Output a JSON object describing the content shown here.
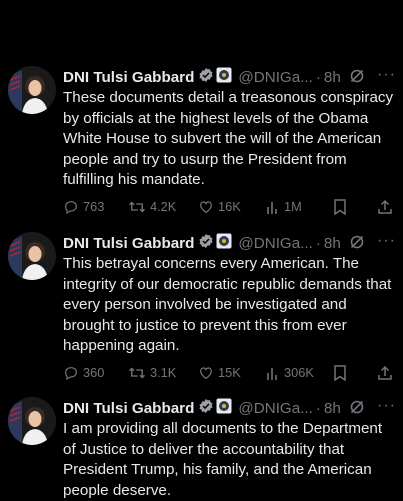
{
  "tweets": [
    {
      "display_name": "DNI Tulsi Gabbard",
      "handle": "@DNIGa...",
      "separator": "·",
      "time": "8h",
      "more": "···",
      "text": "These documents detail a treasonous conspiracy by officials at the highest levels of the Obama White House to subvert the will of the American people and try to usurp the President from fulfilling his mandate.",
      "replies": "763",
      "reposts": "4.2K",
      "likes": "16K",
      "views": "1M"
    },
    {
      "display_name": "DNI Tulsi Gabbard",
      "handle": "@DNIGa...",
      "separator": "·",
      "time": "8h",
      "more": "···",
      "text": "This betrayal concerns every American. The integrity of our democratic republic demands that every person involved be investigated and brought to justice to prevent this from ever happening again.",
      "replies": "360",
      "reposts": "3.1K",
      "likes": "15K",
      "views": "306K"
    },
    {
      "display_name": "DNI Tulsi Gabbard",
      "handle": "@DNIGa...",
      "separator": "·",
      "time": "8h",
      "more": "···",
      "text": "I am providing all documents to the Department of Justice to deliver the accountability that President Trump, his family, and the American people deserve."
    }
  ],
  "colors": {
    "background": "#000000",
    "text": "#e7e9ea",
    "secondary": "#71767b",
    "verified_gold": "#e2b719"
  },
  "icons": {
    "verified": "verified-badge-icon",
    "affiliation": "government-seal-icon",
    "grok": "grok-icon",
    "reply": "reply-icon",
    "repost": "repost-icon",
    "like": "like-icon",
    "views": "views-icon",
    "bookmark": "bookmark-icon",
    "share": "share-icon"
  }
}
